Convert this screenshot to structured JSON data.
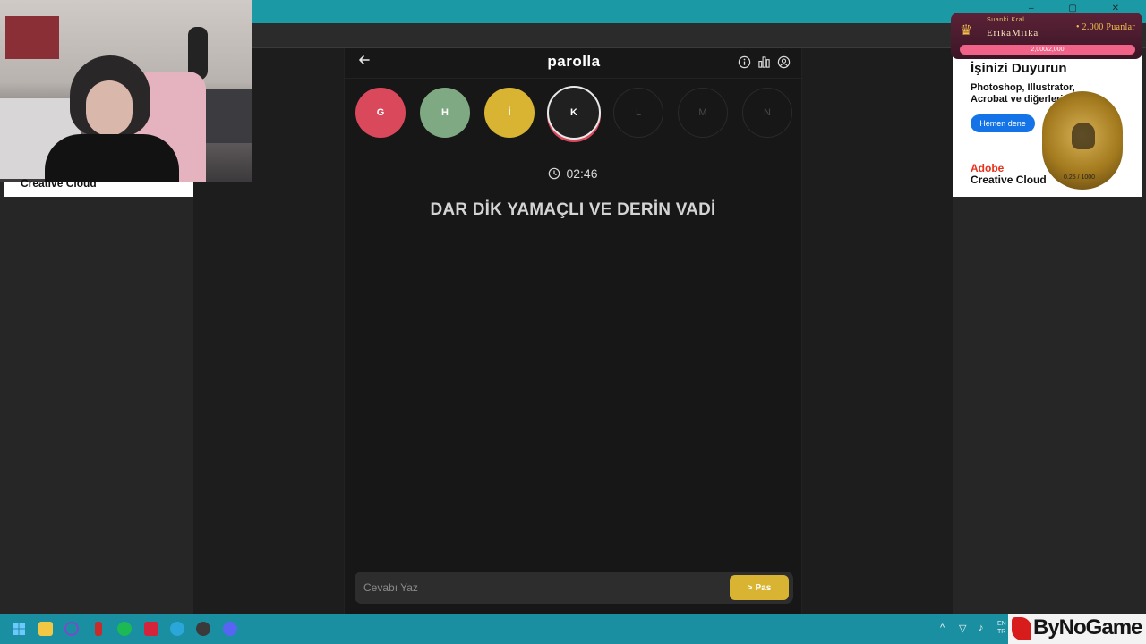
{
  "browser": {
    "title_color": "#1b9aa6"
  },
  "game": {
    "title": "parolla",
    "letters": [
      {
        "letter": "G",
        "state": "wrong"
      },
      {
        "letter": "H",
        "state": "correct"
      },
      {
        "letter": "İ",
        "state": "passed"
      },
      {
        "letter": "K",
        "state": "active"
      },
      {
        "letter": "L",
        "state": "pending"
      },
      {
        "letter": "M",
        "state": "pending"
      },
      {
        "letter": "N",
        "state": "pending"
      }
    ],
    "timer": "02:46",
    "clue": "DAR DİK YAMAÇLI VE DERİN VADİ",
    "answer_placeholder": "Cevabı Yaz",
    "pass_label": "Pas",
    "pass_icon": ">"
  },
  "left_ad": {
    "text": "Creative Cloud"
  },
  "right_ad": {
    "headline": "İşinizi Duyurun",
    "body": "Photoshop, Illustrator, Acrobat ve diğerleri ile",
    "cta": "Hemen dene",
    "brand_line1": "Adobe",
    "brand_line2": "Creative Cloud",
    "counter": "0.25 / 1000"
  },
  "king_overlay": {
    "label": "Suanki Kral",
    "name": "ErikaMiika",
    "points": "• 2.000 Puanlar",
    "progress_text": "2,000/2,000",
    "progress_fraction": 1.0
  },
  "taskbar": {
    "lang_line1": "EN",
    "lang_line2": "TR"
  },
  "watermark": {
    "brand": "ByNoGame"
  },
  "colors": {
    "wrong": "#d9485b",
    "correct": "#7fa982",
    "passed": "#d8b432",
    "accent": "#d8b432"
  }
}
